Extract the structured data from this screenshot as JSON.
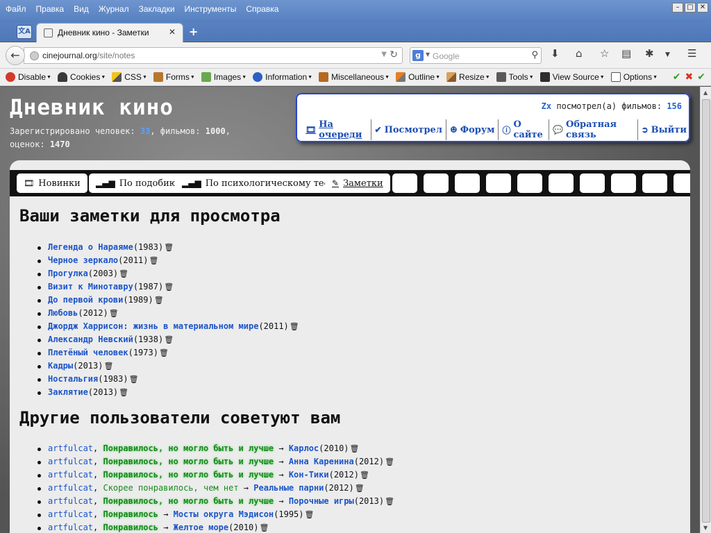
{
  "browser": {
    "menu": [
      "Файл",
      "Правка",
      "Вид",
      "Журнал",
      "Закладки",
      "Инструменты",
      "Справка"
    ],
    "tab_title": "Дневник кино - Заметки",
    "url_host": "cinejournal.org",
    "url_path": "/site/notes",
    "search_placeholder": "Google",
    "devtools": [
      "Disable",
      "Cookies",
      "CSS",
      "Forms",
      "Images",
      "Information",
      "Miscellaneous",
      "Outline",
      "Resize",
      "Tools",
      "View Source",
      "Options"
    ]
  },
  "site": {
    "title": "Дневник кино",
    "stats_label1": "Зарегистрировано человек:",
    "registered": "33",
    "stats_label2": ", фильмов:",
    "films": "1000",
    "stats_label3": ",",
    "stats_label4": "оценок:",
    "ratings": "1470"
  },
  "user": {
    "name": "Zx",
    "watched_label": "посмотрел(а) фильмов:",
    "watched_count": "156",
    "menu": [
      "На очереди",
      "Посмотрел",
      "Форум",
      "О сайте",
      "Обратная связь",
      "Выйти"
    ]
  },
  "content_tabs": [
    "Новинки",
    "По подобию",
    "По психологическому тесту",
    "Заметки"
  ],
  "notes_heading": "Ваши заметки для просмотра",
  "notes": [
    {
      "title": "Легенда о Нараяме",
      "year": "(1983)"
    },
    {
      "title": "Черное зеркало",
      "year": "(2011)"
    },
    {
      "title": "Прогулка",
      "year": "(2003)"
    },
    {
      "title": "Визит к Минотавру",
      "year": "(1987)"
    },
    {
      "title": "До первой крови",
      "year": "(1989)"
    },
    {
      "title": "Любовь",
      "year": "(2012)"
    },
    {
      "title": "Джордж Харрисон: жизнь в материальном мире",
      "year": "(2011)"
    },
    {
      "title": "Александр Невский",
      "year": "(1938)"
    },
    {
      "title": "Плетёный человек",
      "year": "(1973)"
    },
    {
      "title": "Кадры",
      "year": "(2013)"
    },
    {
      "title": "Ностальгия",
      "year": "(1983)"
    },
    {
      "title": "Заклятие",
      "year": "(2013)"
    }
  ],
  "recs_heading": "Другие пользователи советуют вам",
  "recommendations": [
    {
      "user": "artfulcat",
      "verdict": "Понравилось, но могло быть и лучше",
      "film": "Карлос",
      "year": "(2010)",
      "glow": true
    },
    {
      "user": "artfulcat",
      "verdict": "Понравилось, но могло быть и лучше",
      "film": "Анна Каренина",
      "year": "(2012)",
      "glow": true
    },
    {
      "user": "artfulcat",
      "verdict": "Понравилось, но могло быть и лучше",
      "film": "Кон-Тики",
      "year": "(2012)",
      "glow": true
    },
    {
      "user": "artfulcat",
      "verdict": "Скорее понравилось, чем нет",
      "film": "Реальные парни",
      "year": "(2012)",
      "glow": false
    },
    {
      "user": "artfulcat",
      "verdict": "Понравилось, но могло быть и лучше",
      "film": "Порочные игры",
      "year": "(2013)",
      "glow": true
    },
    {
      "user": "artfulcat",
      "verdict": "Понравилось",
      "film": "Мосты округа Мэдисон",
      "year": "(1995)",
      "glow": true
    },
    {
      "user": "artfulcat",
      "verdict": "Понравилось",
      "film": "Желтое море",
      "year": "(2010)",
      "glow": true
    }
  ],
  "colors": {
    "link": "#1c55c9",
    "verdict": "#178a1e",
    "accent": "#5ba2f7"
  }
}
